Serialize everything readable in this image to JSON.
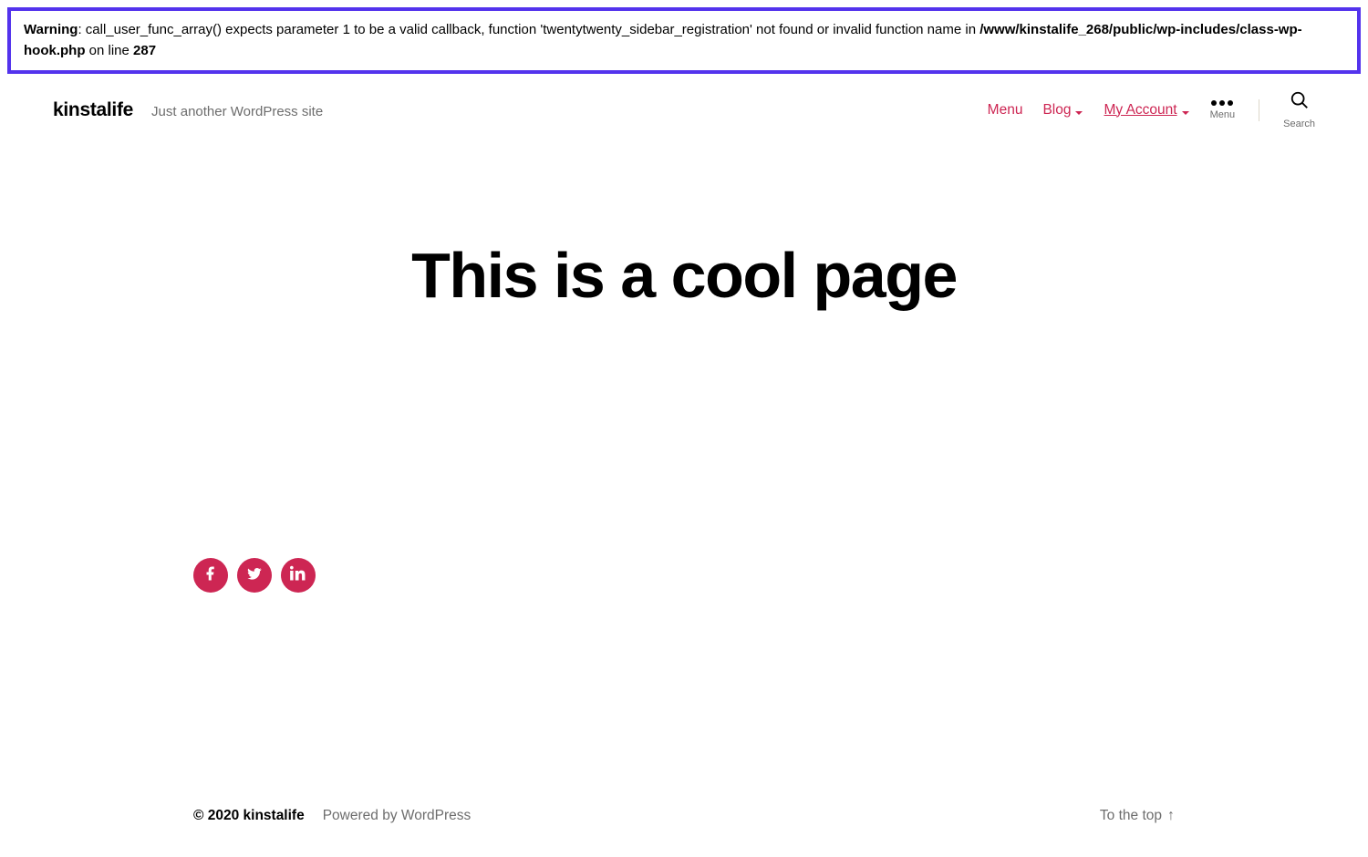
{
  "warning": {
    "prefix": "Warning",
    "text1": ": call_user_func_array() expects parameter 1 to be a valid callback, function 'twentytwenty_sidebar_registration' not found or invalid function name in ",
    "path": "/www/kinstalife_268/public/wp-includes/class-wp-hook.php",
    "text2": " on line ",
    "line": "287"
  },
  "header": {
    "site_title": "kinstalife",
    "tagline": "Just another WordPress site",
    "nav": {
      "menu": "Menu",
      "blog": "Blog",
      "account": "My Account"
    },
    "menu_label": "Menu",
    "search_label": "Search"
  },
  "main": {
    "title": "This is a cool page"
  },
  "social": {
    "facebook": "facebook-icon",
    "twitter": "twitter-icon",
    "linkedin": "linkedin-icon"
  },
  "footer": {
    "copyright": "© 2020 kinstalife",
    "powered": "Powered by WordPress",
    "to_top": "To the top"
  }
}
